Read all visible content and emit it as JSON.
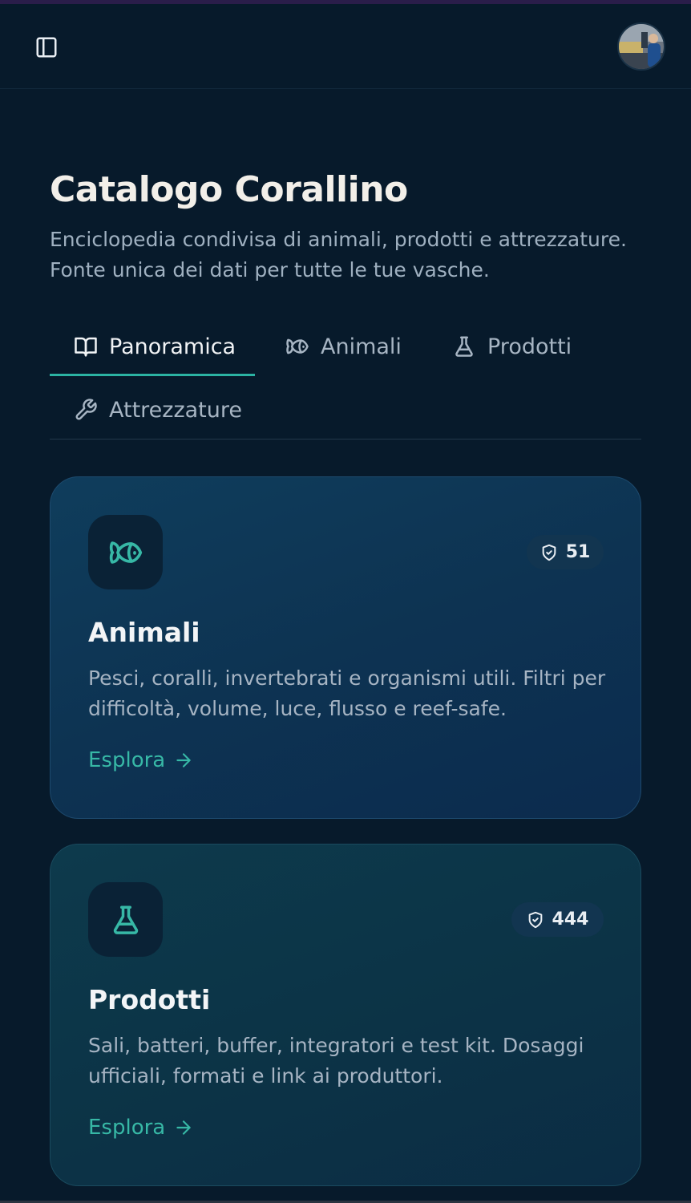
{
  "header": {
    "title": "Catalogo Corallino",
    "subtitle": "Enciclopedia condivisa di animali, prodotti e attrezzature. Fonte unica dei dati per tutte le tue vasche."
  },
  "tabs": [
    {
      "label": "Panoramica",
      "icon": "book-open-icon",
      "active": true
    },
    {
      "label": "Animali",
      "icon": "fish-icon",
      "active": false
    },
    {
      "label": "Prodotti",
      "icon": "flask-icon",
      "active": false
    },
    {
      "label": "Attrezzature",
      "icon": "wrench-icon",
      "active": false
    }
  ],
  "cards": [
    {
      "title": "Animali",
      "count": "51",
      "icon": "fish-icon",
      "description": "Pesci, coralli, invertebrati e organismi utili. Filtri per difficoltà, volume, luce, flusso e reef-safe.",
      "link": "Esplora"
    },
    {
      "title": "Prodotti",
      "count": "444",
      "icon": "flask-icon",
      "description": "Sali, batteri, buffer, integratori e test kit. Dosaggi ufficiali, formati e link ai produttori.",
      "link": "Esplora"
    }
  ],
  "colors": {
    "background": "#071a2b",
    "accent": "#2bb3a3",
    "card_animali": "#0e395a",
    "card_prodotti": "#0c3447"
  }
}
